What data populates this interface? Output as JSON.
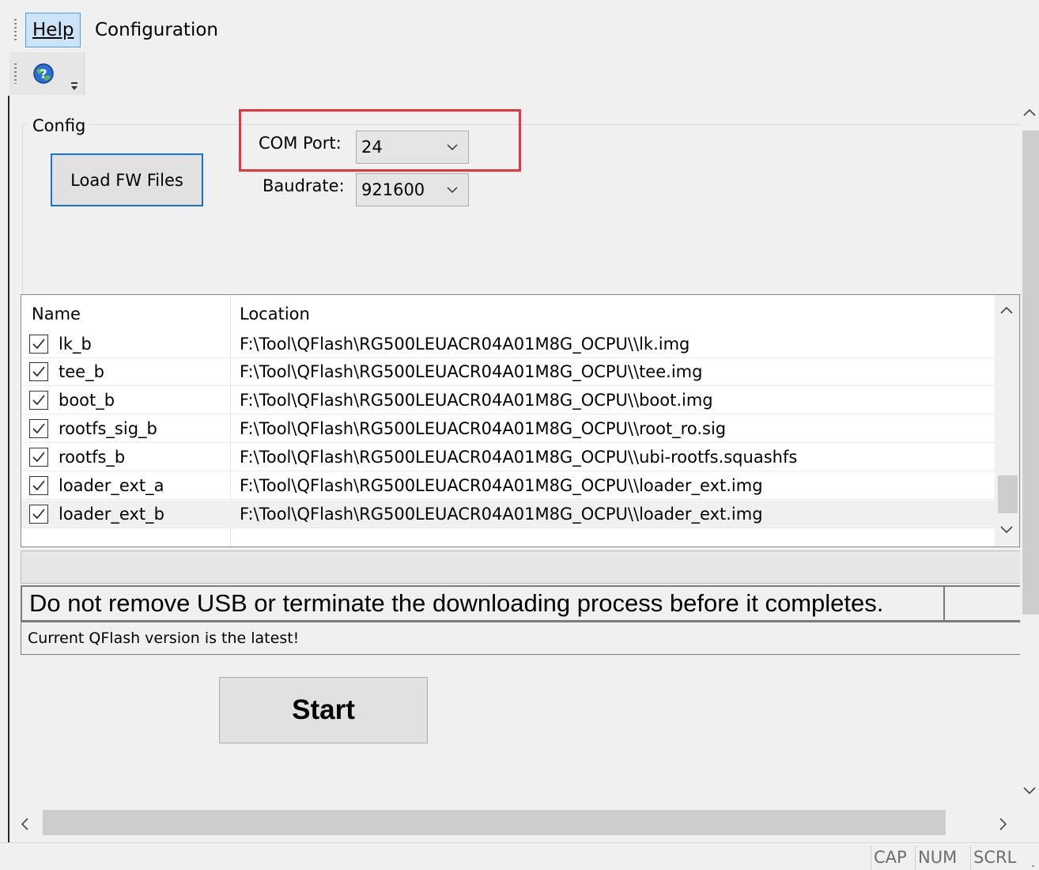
{
  "menu": {
    "help_label": "Help",
    "config_label": "Configuration"
  },
  "toolbar": {
    "help_icon": "help-globe-icon"
  },
  "config": {
    "legend": "Config",
    "load_label": "Load FW Files",
    "com_port_label": "COM Port:",
    "com_port_value": "24",
    "baudrate_label": "Baudrate:",
    "baudrate_value": "921600"
  },
  "list": {
    "columns": [
      "Name",
      "Location"
    ],
    "rows": [
      {
        "name": "lk_b",
        "location": "F:\\Tool\\QFlash\\RG500LEUACR04A01M8G_OCPU\\\\lk.img",
        "checked": true
      },
      {
        "name": "tee_b",
        "location": "F:\\Tool\\QFlash\\RG500LEUACR04A01M8G_OCPU\\\\tee.img",
        "checked": true
      },
      {
        "name": "boot_b",
        "location": "F:\\Tool\\QFlash\\RG500LEUACR04A01M8G_OCPU\\\\boot.img",
        "checked": true
      },
      {
        "name": "rootfs_sig_b",
        "location": "F:\\Tool\\QFlash\\RG500LEUACR04A01M8G_OCPU\\\\root_ro.sig",
        "checked": true
      },
      {
        "name": "rootfs_b",
        "location": "F:\\Tool\\QFlash\\RG500LEUACR04A01M8G_OCPU\\\\ubi-rootfs.squashfs",
        "checked": true
      },
      {
        "name": "loader_ext_a",
        "location": "F:\\Tool\\QFlash\\RG500LEUACR04A01M8G_OCPU\\\\loader_ext.img",
        "checked": true
      },
      {
        "name": "loader_ext_b",
        "location": "F:\\Tool\\QFlash\\RG500LEUACR04A01M8G_OCPU\\\\loader_ext.img",
        "checked": true
      }
    ]
  },
  "status": {
    "warning": "Do not remove USB or terminate the downloading process before it completes.",
    "version": "Current QFlash version is the latest!"
  },
  "start_label": "Start",
  "statusbar": {
    "cap": "CAP",
    "num": "NUM",
    "scrl": "SCRL"
  },
  "colors": {
    "highlight": "#e8353b",
    "focus_border": "#1a73d1",
    "menu_hover": "#cce4f7"
  }
}
